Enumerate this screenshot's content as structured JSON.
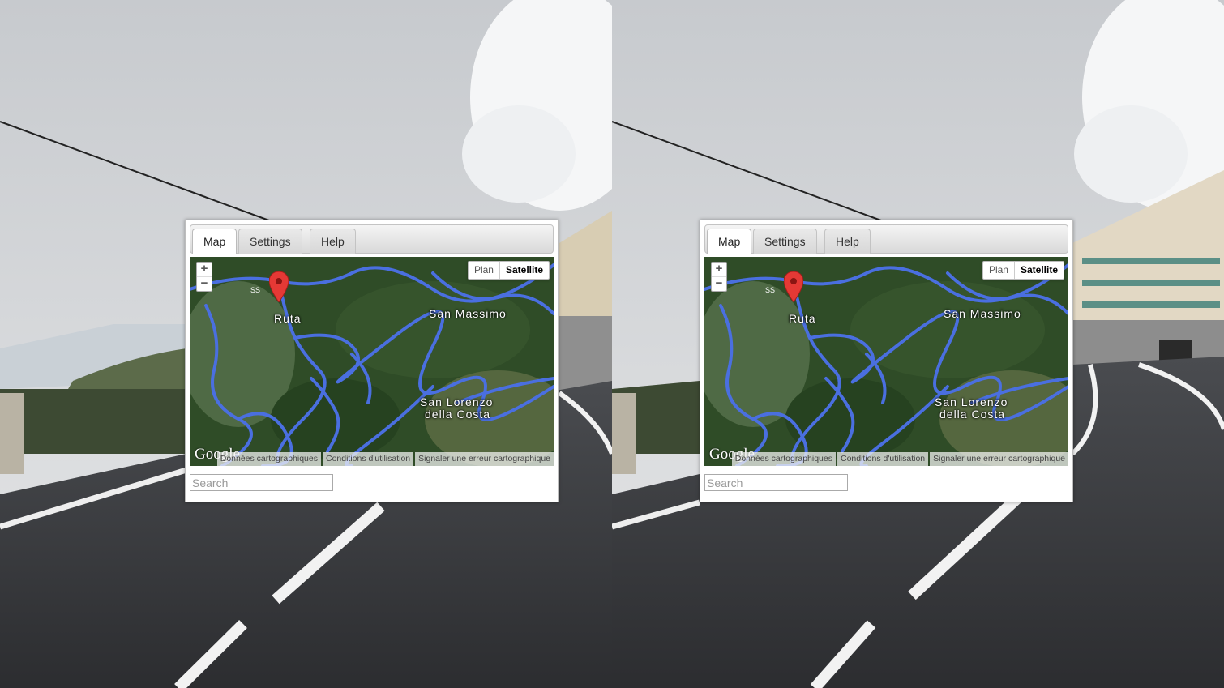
{
  "tabs": [
    {
      "label": "Map"
    },
    {
      "label": "Settings"
    },
    {
      "label": "Help"
    }
  ],
  "map": {
    "zoom_in": "+",
    "zoom_out": "−",
    "map_type_options": [
      "Plan",
      "Satellite"
    ],
    "selected_map_type": "Satellite",
    "places": [
      "Ruta",
      "San Massimo",
      "San Lorenzo",
      "della Costa"
    ],
    "logo": "Google",
    "footer_links": [
      "Données cartographiques",
      "Conditions d'utilisation",
      "Signaler une erreur cartographique"
    ]
  },
  "search": {
    "placeholder": "Search"
  },
  "icons": {
    "marker": "map-marker-icon"
  },
  "colors": {
    "roads": "#4a6fe0",
    "marker": "#e53935",
    "terrain": "#2f4c27"
  }
}
